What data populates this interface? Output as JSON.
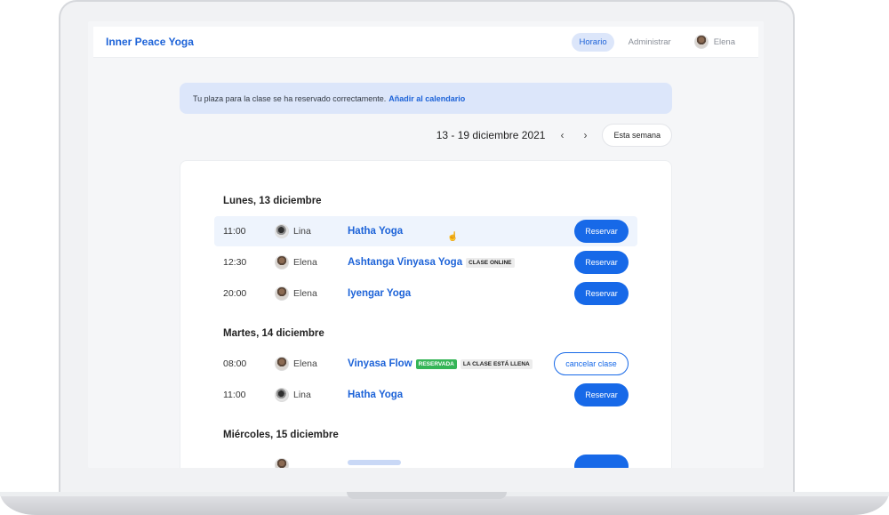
{
  "header": {
    "brand": "Inner Peace Yoga",
    "nav": [
      "Horario",
      "Administrar"
    ],
    "user": "Elena"
  },
  "alert": {
    "message": "Tu plaza para la clase se ha reservado correctamente.",
    "link": "Añadir al calendario"
  },
  "week": {
    "range": "13 - 19 diciembre 2021",
    "prev": "‹",
    "next": "›",
    "current_button": "Esta semana"
  },
  "days": [
    {
      "title": "Lunes, 13 diciembre",
      "classes": [
        {
          "time": "11:00",
          "teacher": "Lina",
          "name": "Hatha Yoga",
          "action": "Reservar"
        },
        {
          "time": "12:30",
          "teacher": "Elena",
          "name": "Ashtanga Vinyasa Yoga",
          "tag": "Clase online",
          "action": "Reservar"
        },
        {
          "time": "20:00",
          "teacher": "Elena",
          "name": "Iyengar Yoga",
          "action": "Reservar"
        }
      ]
    },
    {
      "title": "Martes, 14 diciembre",
      "classes": [
        {
          "time": "08:00",
          "teacher": "Elena",
          "name": "Vinyasa Flow",
          "tag_green": "Reservada",
          "tag": "La clase está llena",
          "action": "cancelar clase"
        },
        {
          "time": "11:00",
          "teacher": "Lina",
          "name": "Hatha Yoga",
          "action": "Reservar"
        }
      ]
    },
    {
      "title": "Miércoles, 15 diciembre",
      "classes": []
    }
  ],
  "colors": {
    "accent": "#1769e8",
    "brand": "#1d63d8",
    "alert_bg": "#dce6fa",
    "reserved": "#35b557"
  },
  "icons": {
    "cursor": "hand-pointer-icon"
  }
}
